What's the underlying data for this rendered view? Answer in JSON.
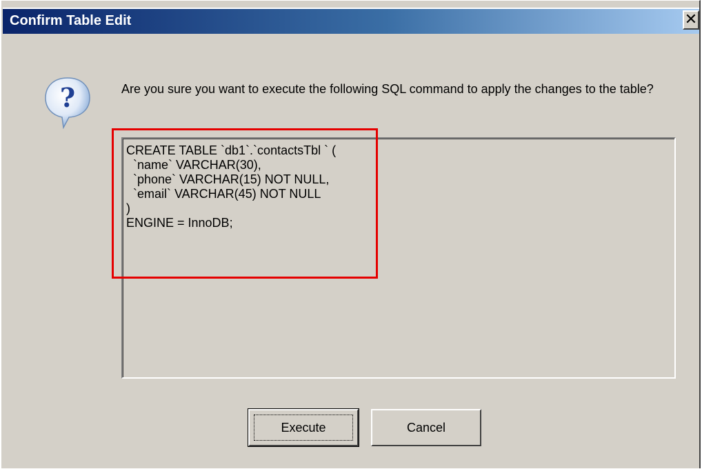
{
  "window": {
    "title": "Confirm Table Edit",
    "close_glyph": "✕"
  },
  "icon": {
    "name": "question-icon",
    "glyph": "?"
  },
  "message": "Are you sure you want to execute the following SQL command to apply the changes to the table?",
  "sql": "CREATE TABLE `db1`.`contactsTbl ` (\n  `name` VARCHAR(30),\n  `phone` VARCHAR(15) NOT NULL,\n  `email` VARCHAR(45) NOT NULL\n)\nENGINE = InnoDB;",
  "buttons": {
    "execute_label": "Execute",
    "cancel_label": "Cancel"
  },
  "colors": {
    "titlebar_start": "#0a246a",
    "titlebar_end": "#a6caf0",
    "dialog_bg": "#d4d0c8",
    "highlight": "#e50000"
  }
}
